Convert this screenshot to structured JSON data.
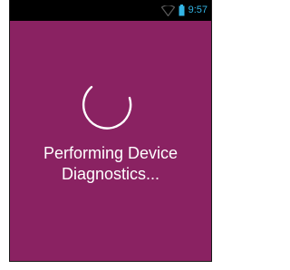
{
  "status_bar": {
    "time": "9:57",
    "icons": [
      "wifi-icon",
      "battery-icon"
    ],
    "background": "#000000",
    "accent": "#33b5e5"
  },
  "screen": {
    "background": "#8a2262",
    "spinner": "loading-spinner-icon",
    "message_line1": "Performing Device",
    "message_line2": "Diagnostics..."
  }
}
